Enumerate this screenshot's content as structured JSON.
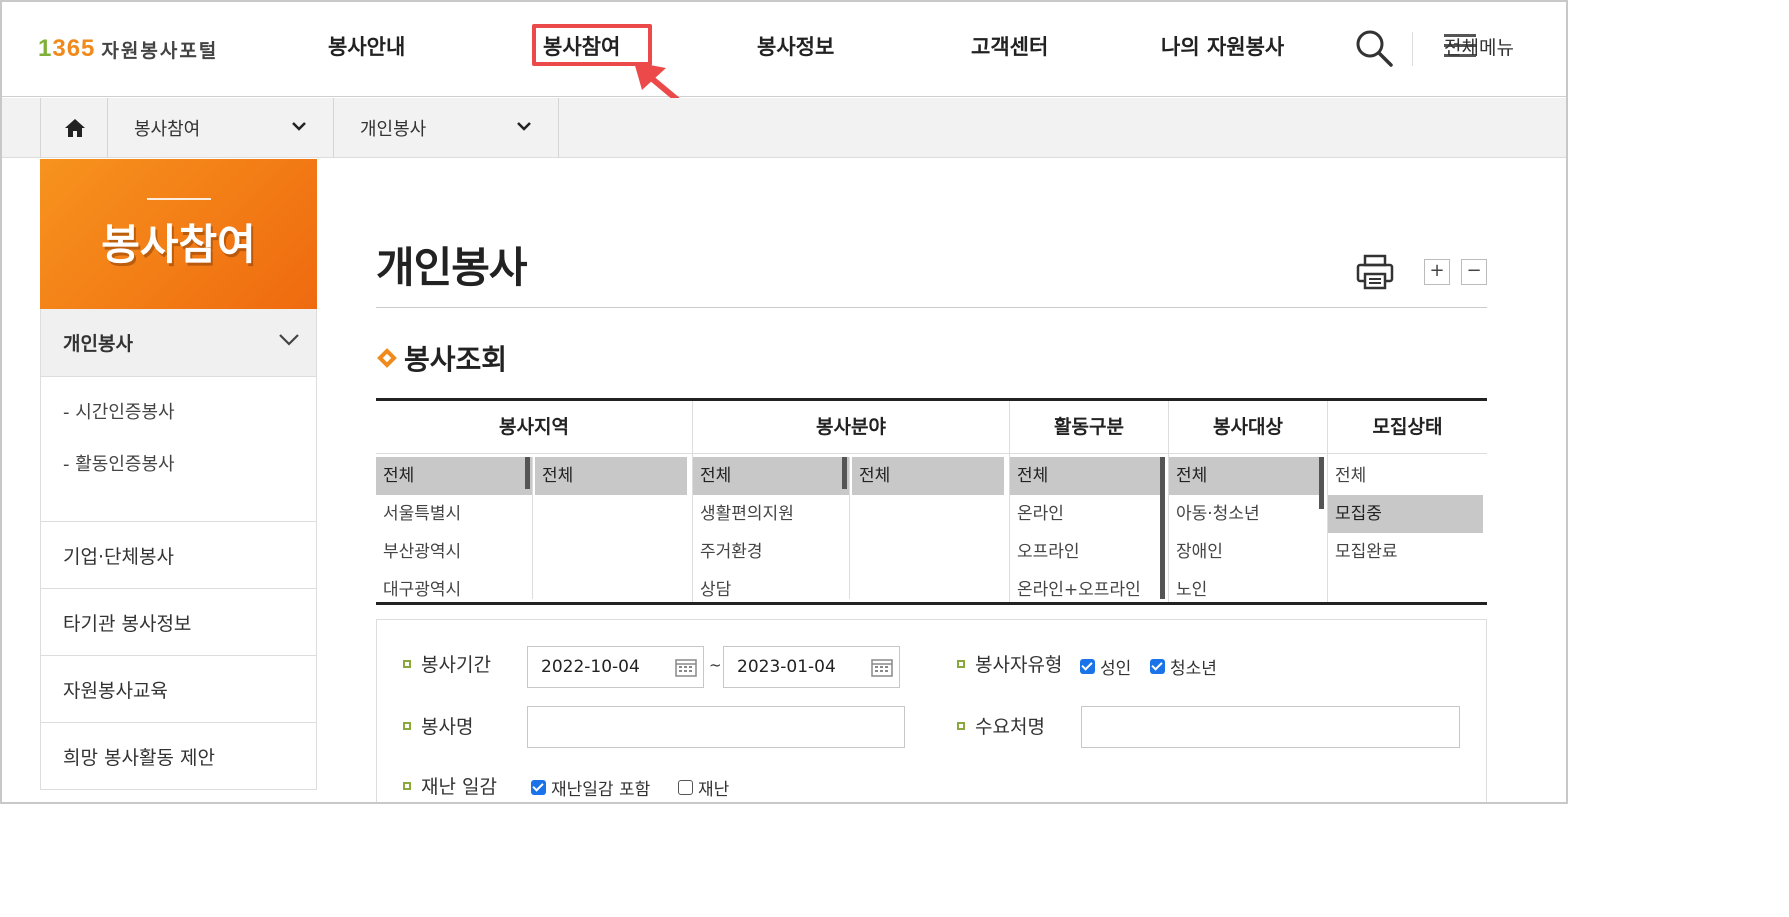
{
  "header": {
    "logo_number": "1365",
    "logo_text": "자원봉사포털",
    "nav": [
      "봉사안내",
      "봉사참여",
      "봉사정보",
      "고객센터",
      "나의 자원봉사"
    ],
    "all_menu_label": "전체메뉴"
  },
  "breadcrumb": {
    "level1": "봉사참여",
    "level2": "개인봉사"
  },
  "sidebar": {
    "title": "봉사참여",
    "active": "개인봉사",
    "sub_items": [
      "- 시간인증봉사",
      "- 활동인증봉사"
    ],
    "items": [
      "기업·단체봉사",
      "타기관 봉사정보",
      "자원봉사교육",
      "희망 봉사활동 제안"
    ]
  },
  "main": {
    "page_title": "개인봉사",
    "zoom_in": "+",
    "zoom_out": "−",
    "section_title": "봉사조회"
  },
  "filter": {
    "columns": [
      {
        "header": "봉사지역",
        "list_a": [
          "전체",
          "서울특별시",
          "부산광역시",
          "대구광역시"
        ],
        "list_b": [
          "전체"
        ]
      },
      {
        "header": "봉사분야",
        "list_a": [
          "전체",
          "생활편의지원",
          "주거환경",
          "상담"
        ],
        "list_b": [
          "전체"
        ]
      },
      {
        "header": "활동구분",
        "list_a": [
          "전체",
          "온라인",
          "오프라인",
          "온라인+오프라인"
        ]
      },
      {
        "header": "봉사대상",
        "list_a": [
          "전체",
          "아동·청소년",
          "장애인",
          "노인"
        ]
      },
      {
        "header": "모집상태",
        "list_a": [
          "전체",
          "모집중",
          "모집완료"
        ]
      }
    ]
  },
  "form": {
    "period_label": "봉사기간",
    "start_date": "2022-10-04",
    "tilde": "~",
    "end_date": "2023-01-04",
    "volunteer_type_label": "봉사자유형",
    "adult_label": "성인",
    "youth_label": "청소년",
    "name_label": "봉사명",
    "org_label": "수요처명",
    "disaster_label": "재난 일감",
    "disaster_include_label": "재난일감 포함",
    "disaster_only_label": "재난"
  },
  "colors": {
    "accent_orange": "#f08a1c",
    "highlight_red": "#ec4a4a",
    "checkbox_blue": "#1a73e8"
  }
}
